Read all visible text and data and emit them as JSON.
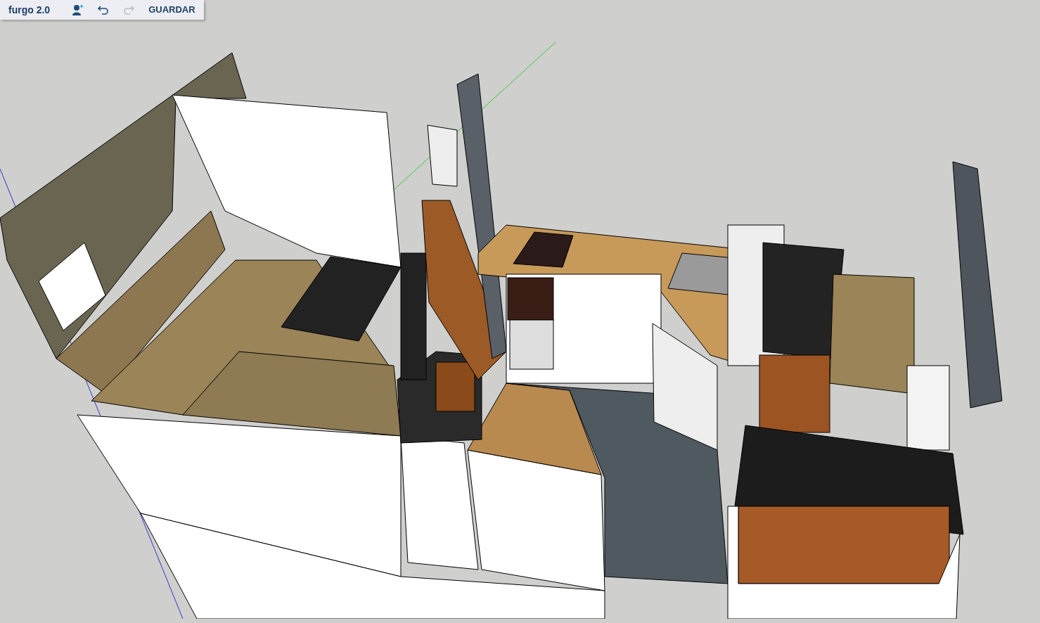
{
  "toolbar": {
    "title": "furgo 2.0",
    "tools": [
      {
        "kind": "add-user",
        "disabled": false
      },
      {
        "kind": "undo",
        "disabled": false
      },
      {
        "kind": "redo",
        "disabled": true
      }
    ],
    "save_label": "GUARDAR"
  }
}
